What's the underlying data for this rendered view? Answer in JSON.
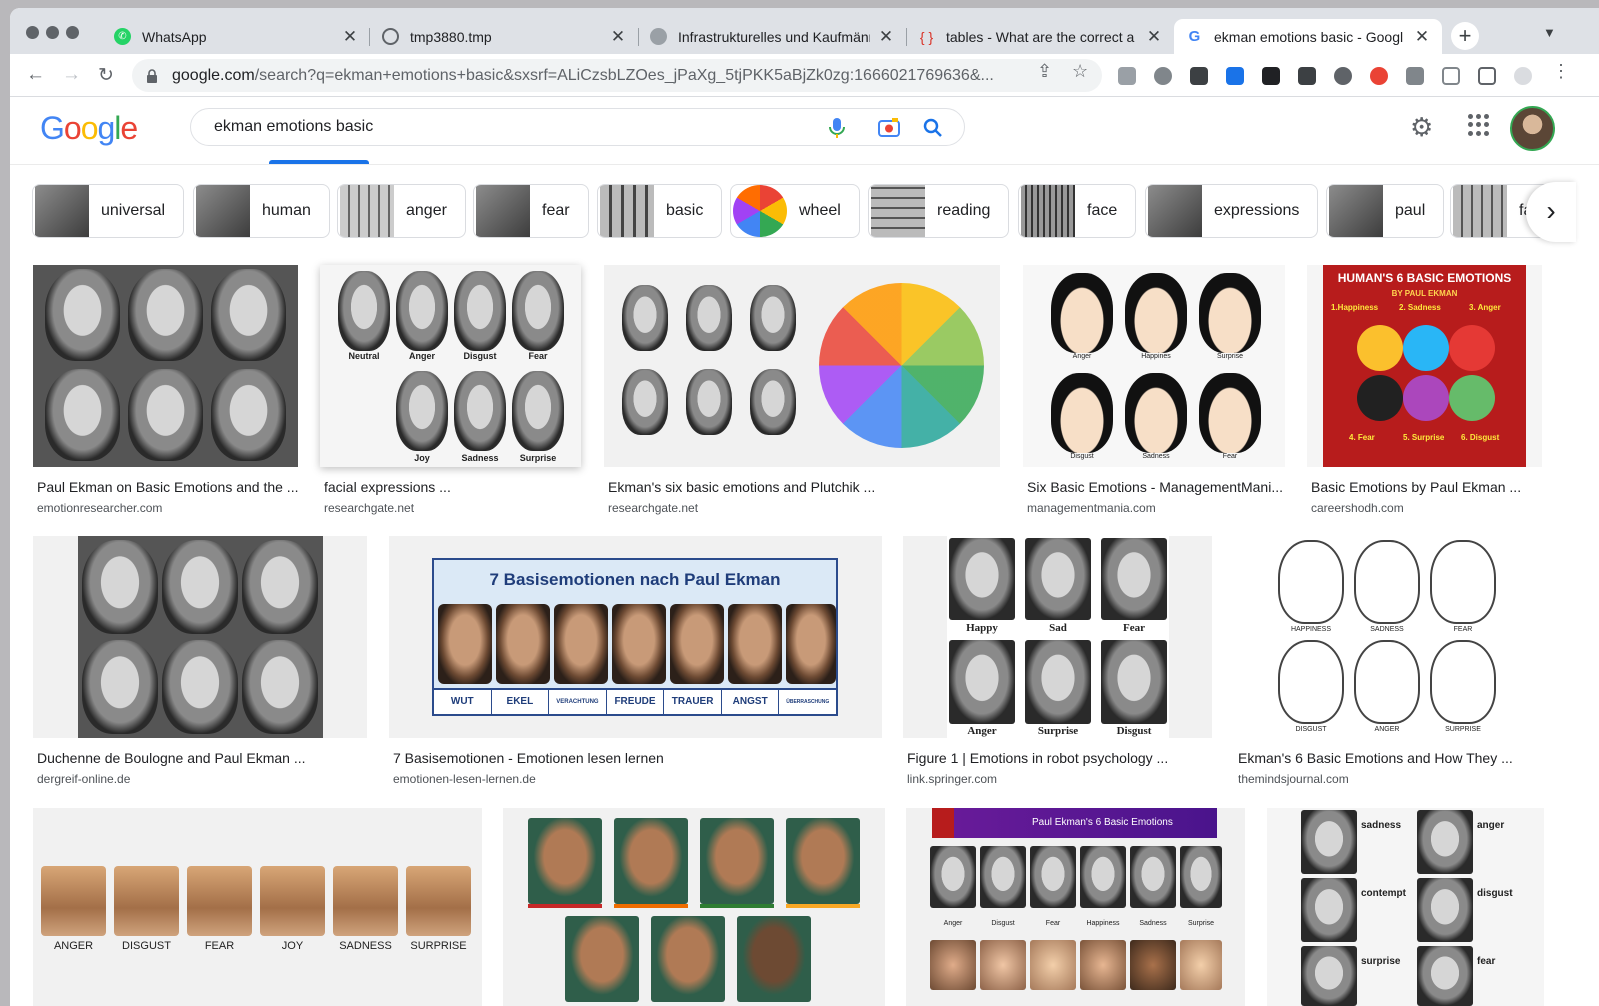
{
  "tabs": [
    {
      "title": "WhatsApp",
      "icon": "whatsapp-icon"
    },
    {
      "title": "tmp3880.tmp",
      "icon": "globe-icon"
    },
    {
      "title": "Infrastrukturelles und Kaufmänn",
      "icon": "site-icon"
    },
    {
      "title": "tables - What are the correct a",
      "icon": "braces-icon"
    },
    {
      "title": "ekman emotions basic - Googl",
      "icon": "google-icon"
    }
  ],
  "address_bar": {
    "domain": "google.com",
    "path": "/search?q=ekman+emotions+basic&sxsrf=ALiCzsbLZOes_jPaXg_5tjPKK5aBjZk0zg:1666021769636&..."
  },
  "search": {
    "query": "ekman emotions basic"
  },
  "chips": [
    "universal",
    "human",
    "anger",
    "fear",
    "basic",
    "wheel",
    "reading",
    "face",
    "expressions",
    "paul",
    "fa"
  ],
  "results": [
    {
      "caption": "Paul Ekman on Basic Emotions and the ...",
      "source": "emotionresearcher.com"
    },
    {
      "caption": "facial expressions ...",
      "source": "researchgate.net",
      "labels": [
        "Neutral",
        "Anger",
        "Disgust",
        "Fear",
        "Joy",
        "Sadness",
        "Surprise"
      ]
    },
    {
      "caption": "Ekman's six basic emotions and Plutchik ...",
      "source": "researchgate.net"
    },
    {
      "caption": "Six Basic Emotions - ManagementMani...",
      "source": "managementmania.com",
      "labels": [
        "Anger",
        "Happines",
        "Surprise",
        "Disgust",
        "Sadness",
        "Fear"
      ]
    },
    {
      "caption": "Basic Emotions by Paul Ekman ...",
      "source": "careershodh.com",
      "title": "HUMAN'S 6 BASIC EMOTIONS",
      "byline": "BY PAUL EKMAN",
      "items": [
        "1.Happiness",
        "2. Sadness",
        "3. Anger",
        "4. Fear",
        "5. Surprise",
        "6. Disgust"
      ]
    },
    {
      "caption": "Duchenne de Boulogne and Paul Ekman ...",
      "source": "dergreif-online.de"
    },
    {
      "caption": "7 Basisemotionen - Emotionen lesen lernen",
      "source": "emotionen-lesen-lernen.de",
      "title": "7 Basisemotionen nach Paul Ekman",
      "labels": [
        "WUT",
        "EKEL",
        "VERACHTUNG",
        "FREUDE",
        "TRAUER",
        "ANGST",
        "ÜBERRASCHUNG"
      ]
    },
    {
      "caption": "Figure 1 | Emotions in robot psychology ...",
      "source": "link.springer.com",
      "labels": [
        "Happy",
        "Sad",
        "Fear",
        "Anger",
        "Surprise",
        "Disgust"
      ]
    },
    {
      "caption": "Ekman's 6 Basic Emotions and How They ...",
      "source": "themindsjournal.com",
      "labels": [
        "HAPPINESS",
        "SADNESS",
        "FEAR",
        "DISGUST",
        "ANGER",
        "SURPRISE"
      ]
    },
    {
      "labels": [
        "ANGER",
        "DISGUST",
        "FEAR",
        "JOY",
        "SADNESS",
        "SURPRISE"
      ]
    },
    {},
    {
      "title": "Paul Ekman's 6 Basic Emotions",
      "labels": [
        "Anger",
        "Disgust",
        "Fear",
        "Happiness",
        "Sadness",
        "Surprise"
      ]
    },
    {
      "labels": [
        "sadness",
        "anger",
        "contempt",
        "disgust",
        "surprise",
        "fear"
      ]
    }
  ]
}
